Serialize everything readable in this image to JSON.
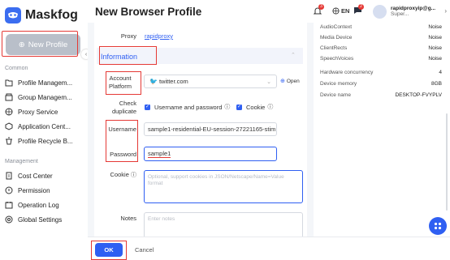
{
  "brand": {
    "name": "Maskfog"
  },
  "sidebar": {
    "new_profile": "New Profile",
    "common_title": "Common",
    "common_items": [
      {
        "label": "Profile Managem..."
      },
      {
        "label": "Group Managem..."
      },
      {
        "label": "Proxy Service"
      },
      {
        "label": "Application Cent..."
      },
      {
        "label": "Profile Recycle B..."
      }
    ],
    "management_title": "Management",
    "management_items": [
      {
        "label": "Cost Center"
      },
      {
        "label": "Permission"
      },
      {
        "label": "Operation Log"
      },
      {
        "label": "Global Settings"
      }
    ]
  },
  "header": {
    "title": "New Browser Profile",
    "notif_count": "3",
    "language": "EN",
    "msg_count": "2",
    "user_name": "rapidproxyip@g...",
    "user_role": "Super..."
  },
  "form": {
    "proxy_label": "Proxy",
    "proxy_value": "rapidproxy",
    "section_title": "Information",
    "account_platform_label_1": "Account",
    "account_platform_label_2": "Platform",
    "account_platform_value": "twitter.com",
    "open_label": "Open",
    "check_dup_label_1": "Check",
    "check_dup_label_2": "duplicate",
    "check_user_pass": "Username and password",
    "check_cookie": "Cookie",
    "username_label": "Username",
    "username_value": "sample1-residential-EU-session-27221165-stim",
    "password_label": "Password",
    "password_value": "sample1",
    "cookie_label": "Cookie",
    "cookie_placeholder": "Optional, support cookies in JSON/Netscape/Name=Value format",
    "notes_label": "Notes",
    "notes_placeholder": "Enter notes"
  },
  "fingerprint": [
    {
      "key": "AudioContext",
      "value": "Noise"
    },
    {
      "key": "Media Device",
      "value": "Noise"
    },
    {
      "key": "ClientRects",
      "value": "Noise"
    },
    {
      "key": "SpeechVoices",
      "value": "Noise"
    },
    {
      "key": "Hardware concurrency",
      "value": "4"
    },
    {
      "key": "Device memory",
      "value": "8GB"
    },
    {
      "key": "Device name",
      "value": "DESKTOP-FVYPLV"
    }
  ],
  "footer": {
    "ok": "OK",
    "cancel": "Cancel"
  },
  "colors": {
    "accent": "#2f5ff2",
    "highlight": "#e53935"
  }
}
